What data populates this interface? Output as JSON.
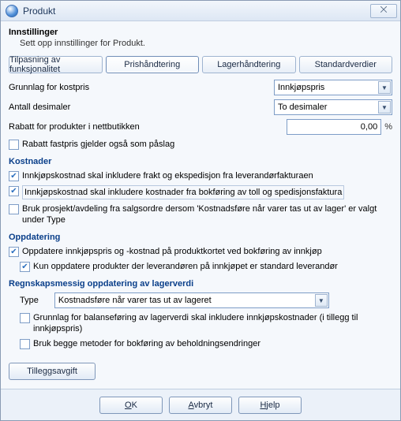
{
  "window": {
    "title": "Produkt",
    "closeGlyph": "⨉"
  },
  "settings": {
    "heading": "Innstillinger",
    "subheading": "Sett opp innstillinger for Produkt."
  },
  "tabs": {
    "funksjonalitet": "Tilpasning av funksjonalitet",
    "prishandtering": "Prishåndtering",
    "lagerhandtering": "Lagerhåndtering",
    "standardverdier": "Standardverdier"
  },
  "form": {
    "grunnlagLabel": "Grunnlag for kostpris",
    "grunnlagValue": "Innkjøpspris",
    "antallDesimalerLabel": "Antall desimaler",
    "antallDesimalerValue": "To desimaler",
    "rabattNettLabel": "Rabatt for produkter i nettbutikken",
    "rabattNettValue": "0,00",
    "pct": "%",
    "rabattFastpris": {
      "checked": false,
      "label": "Rabatt fastpris gjelder også som påslag"
    }
  },
  "kostnader": {
    "title": "Kostnader",
    "frakt": {
      "checked": true,
      "label": "Innkjøpskostnad skal inkludere frakt og ekspedisjon fra leverandørfakturaen"
    },
    "toll": {
      "checked": true,
      "label": "Innkjøpskostnad skal inkludere kostnader fra bokføring av toll og spedisjonsfaktura"
    },
    "prosjekt": {
      "checked": false,
      "label": "Bruk prosjekt/avdeling fra salgsordre dersom 'Kostnadsføre når varer tas ut av lager' er valgt under Type"
    }
  },
  "oppdatering": {
    "title": "Oppdatering",
    "oppdaterePris": {
      "checked": true,
      "label": "Oppdatere innkjøpspris og -kostnad på produktkortet ved bokføring av innkjøp"
    },
    "kunStandard": {
      "checked": true,
      "label": "Kun oppdatere produkter der leverandøren på innkjøpet er standard leverandør"
    }
  },
  "regnskap": {
    "title": "Regnskapsmessig oppdatering av lagerverdi",
    "typeLabel": "Type",
    "typeValue": "Kostnadsføre når varer tas ut av lageret",
    "grunnlagBalanse": {
      "checked": false,
      "label": "Grunnlag for balanseføring av lagerverdi skal inkludere innkjøpskostnader (i tillegg til innkjøpspris)"
    },
    "beggeMetoder": {
      "checked": false,
      "label": "Bruk begge metoder for bokføring av beholdningsendringer"
    }
  },
  "buttons": {
    "tilleggsavgift": "Tilleggsavgift",
    "ok": "OK",
    "avbryt": "Avbryt",
    "hjelp": "Hjelp"
  },
  "arrowGlyph": "▼",
  "checkGlyph": "✔"
}
